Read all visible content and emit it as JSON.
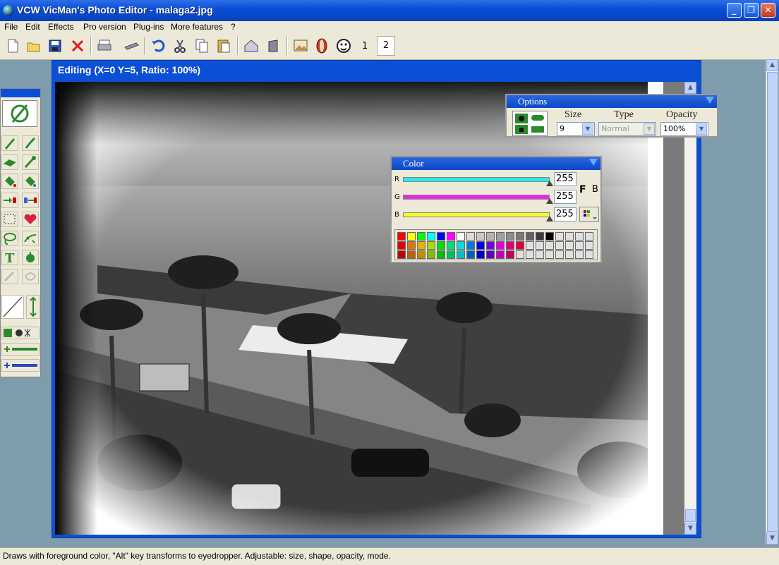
{
  "window": {
    "title": "VCW VicMan's Photo Editor - malaga2.jpg"
  },
  "menu": [
    "File",
    "Edit",
    "Effects",
    "Pro version",
    "Plug-ins",
    "More features",
    "?"
  ],
  "toolbar": {
    "icons": [
      "new-document-icon",
      "open-folder-icon",
      "save-disk-icon",
      "close-x-icon",
      "print-icon",
      "scan-icon",
      "undo-icon",
      "cut-icon",
      "copy-icon",
      "paste-icon",
      "export-icon",
      "page-icon",
      "image-effect-icon",
      "face-mask-icon",
      "face-cartoon-icon"
    ],
    "page_tabs": [
      "1",
      "2"
    ]
  },
  "editor": {
    "title": "Editing (X=0 Y=5, Ratio: 100%)"
  },
  "options_panel": {
    "title": "Options",
    "size_label": "Size",
    "size_value": "9",
    "type_label": "Type",
    "type_value": "Normal",
    "opacity_label": "Opacity",
    "opacity_value": "100%"
  },
  "color_panel": {
    "title": "Color",
    "channels": [
      {
        "label": "R",
        "value": "255",
        "color": "#28e8e8"
      },
      {
        "label": "G",
        "value": "255",
        "color": "#e828e8"
      },
      {
        "label": "B",
        "value": "255",
        "color": "#f8f828"
      }
    ],
    "fg_label": "F",
    "bg_label": "B",
    "palette_colors": [
      "#ff0000",
      "#ffff00",
      "#00ff00",
      "#00ffff",
      "#0000ff",
      "#ff00ff",
      "#ffffff",
      "#dcdcdc",
      "#c8c8c8",
      "#b4b4b4",
      "#a0a0a0",
      "#8c8c8c",
      "#787878",
      "#646464",
      "#3c3c3c",
      "#000000",
      "#e0e0e0",
      "#e0e0e0",
      "#e0e0e0",
      "#e0e0e0",
      "#e00000",
      "#e07800",
      "#e0b400",
      "#a0e000",
      "#00e000",
      "#00e078",
      "#00e0e0",
      "#0078e0",
      "#0000e0",
      "#7800e0",
      "#e000e0",
      "#e00078",
      "#e00040",
      "#e0e0e0",
      "#e0e0e0",
      "#e0e0e0",
      "#e0e0e0",
      "#e0e0e0",
      "#e0e0e0",
      "#e0e0e0",
      "#c00000",
      "#c06000",
      "#c09000",
      "#80c000",
      "#00c000",
      "#00c060",
      "#00c0c0",
      "#0060c0",
      "#0000c0",
      "#6000c0",
      "#c000c0",
      "#c00060",
      "#e0e0e0",
      "#e0e0e0",
      "#e0e0e0",
      "#e0e0e0",
      "#e0e0e0",
      "#e0e0e0",
      "#e0e0e0",
      "#e0e0e0"
    ]
  },
  "status": "Draws with foreground color, \"Alt\" key transforms to eyedropper. Adjustable: size, shape, opacity, mode."
}
